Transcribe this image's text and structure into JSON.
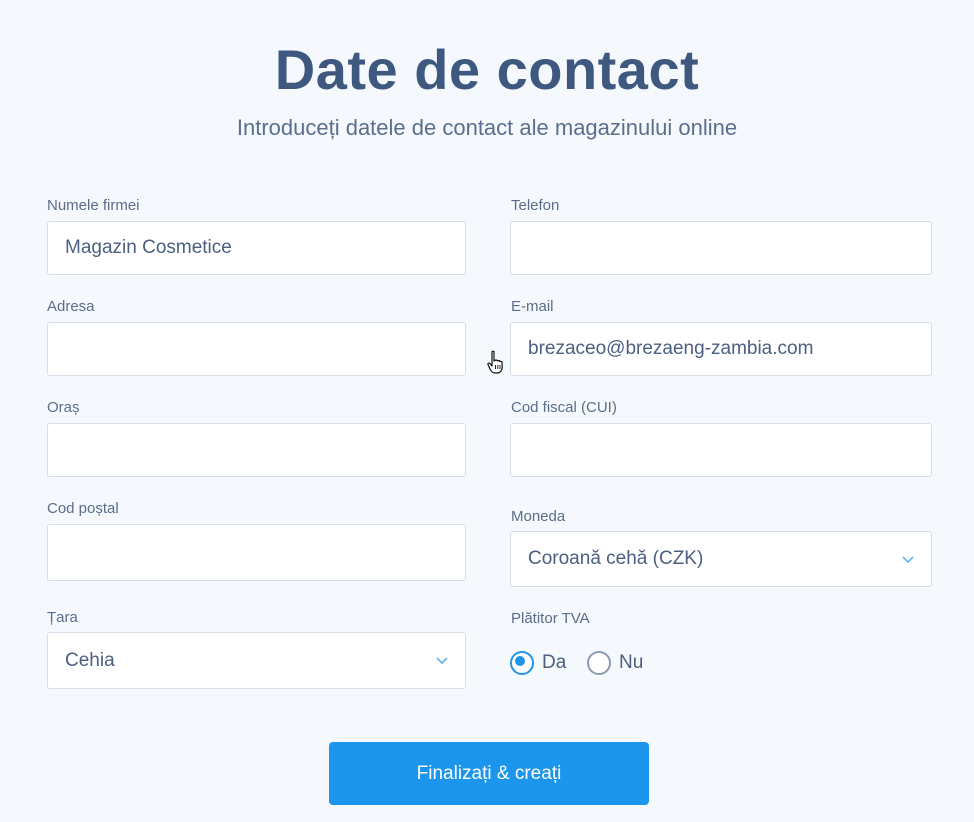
{
  "header": {
    "title": "Date de contact",
    "subtitle": "Introduceți datele de contact ale magazinului online"
  },
  "form": {
    "company": {
      "label": "Numele firmei",
      "value": "Magazin Cosmetice"
    },
    "phone": {
      "label": "Telefon",
      "value": ""
    },
    "address": {
      "label": "Adresa",
      "value": ""
    },
    "email": {
      "label": "E-mail",
      "value": "brezaceo@brezaeng-zambia.com"
    },
    "city": {
      "label": "Oraș",
      "value": ""
    },
    "tax_code": {
      "label": "Cod fiscal (CUI)",
      "value": ""
    },
    "postal_code": {
      "label": "Cod poștal",
      "value": ""
    },
    "currency": {
      "label": "Moneda",
      "value": "Coroană cehă (CZK)"
    },
    "country": {
      "label": "Țara",
      "value": "Cehia"
    },
    "vat_payer": {
      "label": "Plătitor TVA",
      "options": [
        {
          "label": "Da",
          "checked": true
        },
        {
          "label": "Nu",
          "checked": false
        }
      ]
    }
  },
  "submit": {
    "label": "Finalizați & creați"
  },
  "colors": {
    "accent": "#1b96ec",
    "title": "#3f5880",
    "background": "#f5f8fc"
  },
  "icons": {
    "select_arrow": "chevron-down-icon",
    "cursor": "hand-pointer-icon"
  }
}
